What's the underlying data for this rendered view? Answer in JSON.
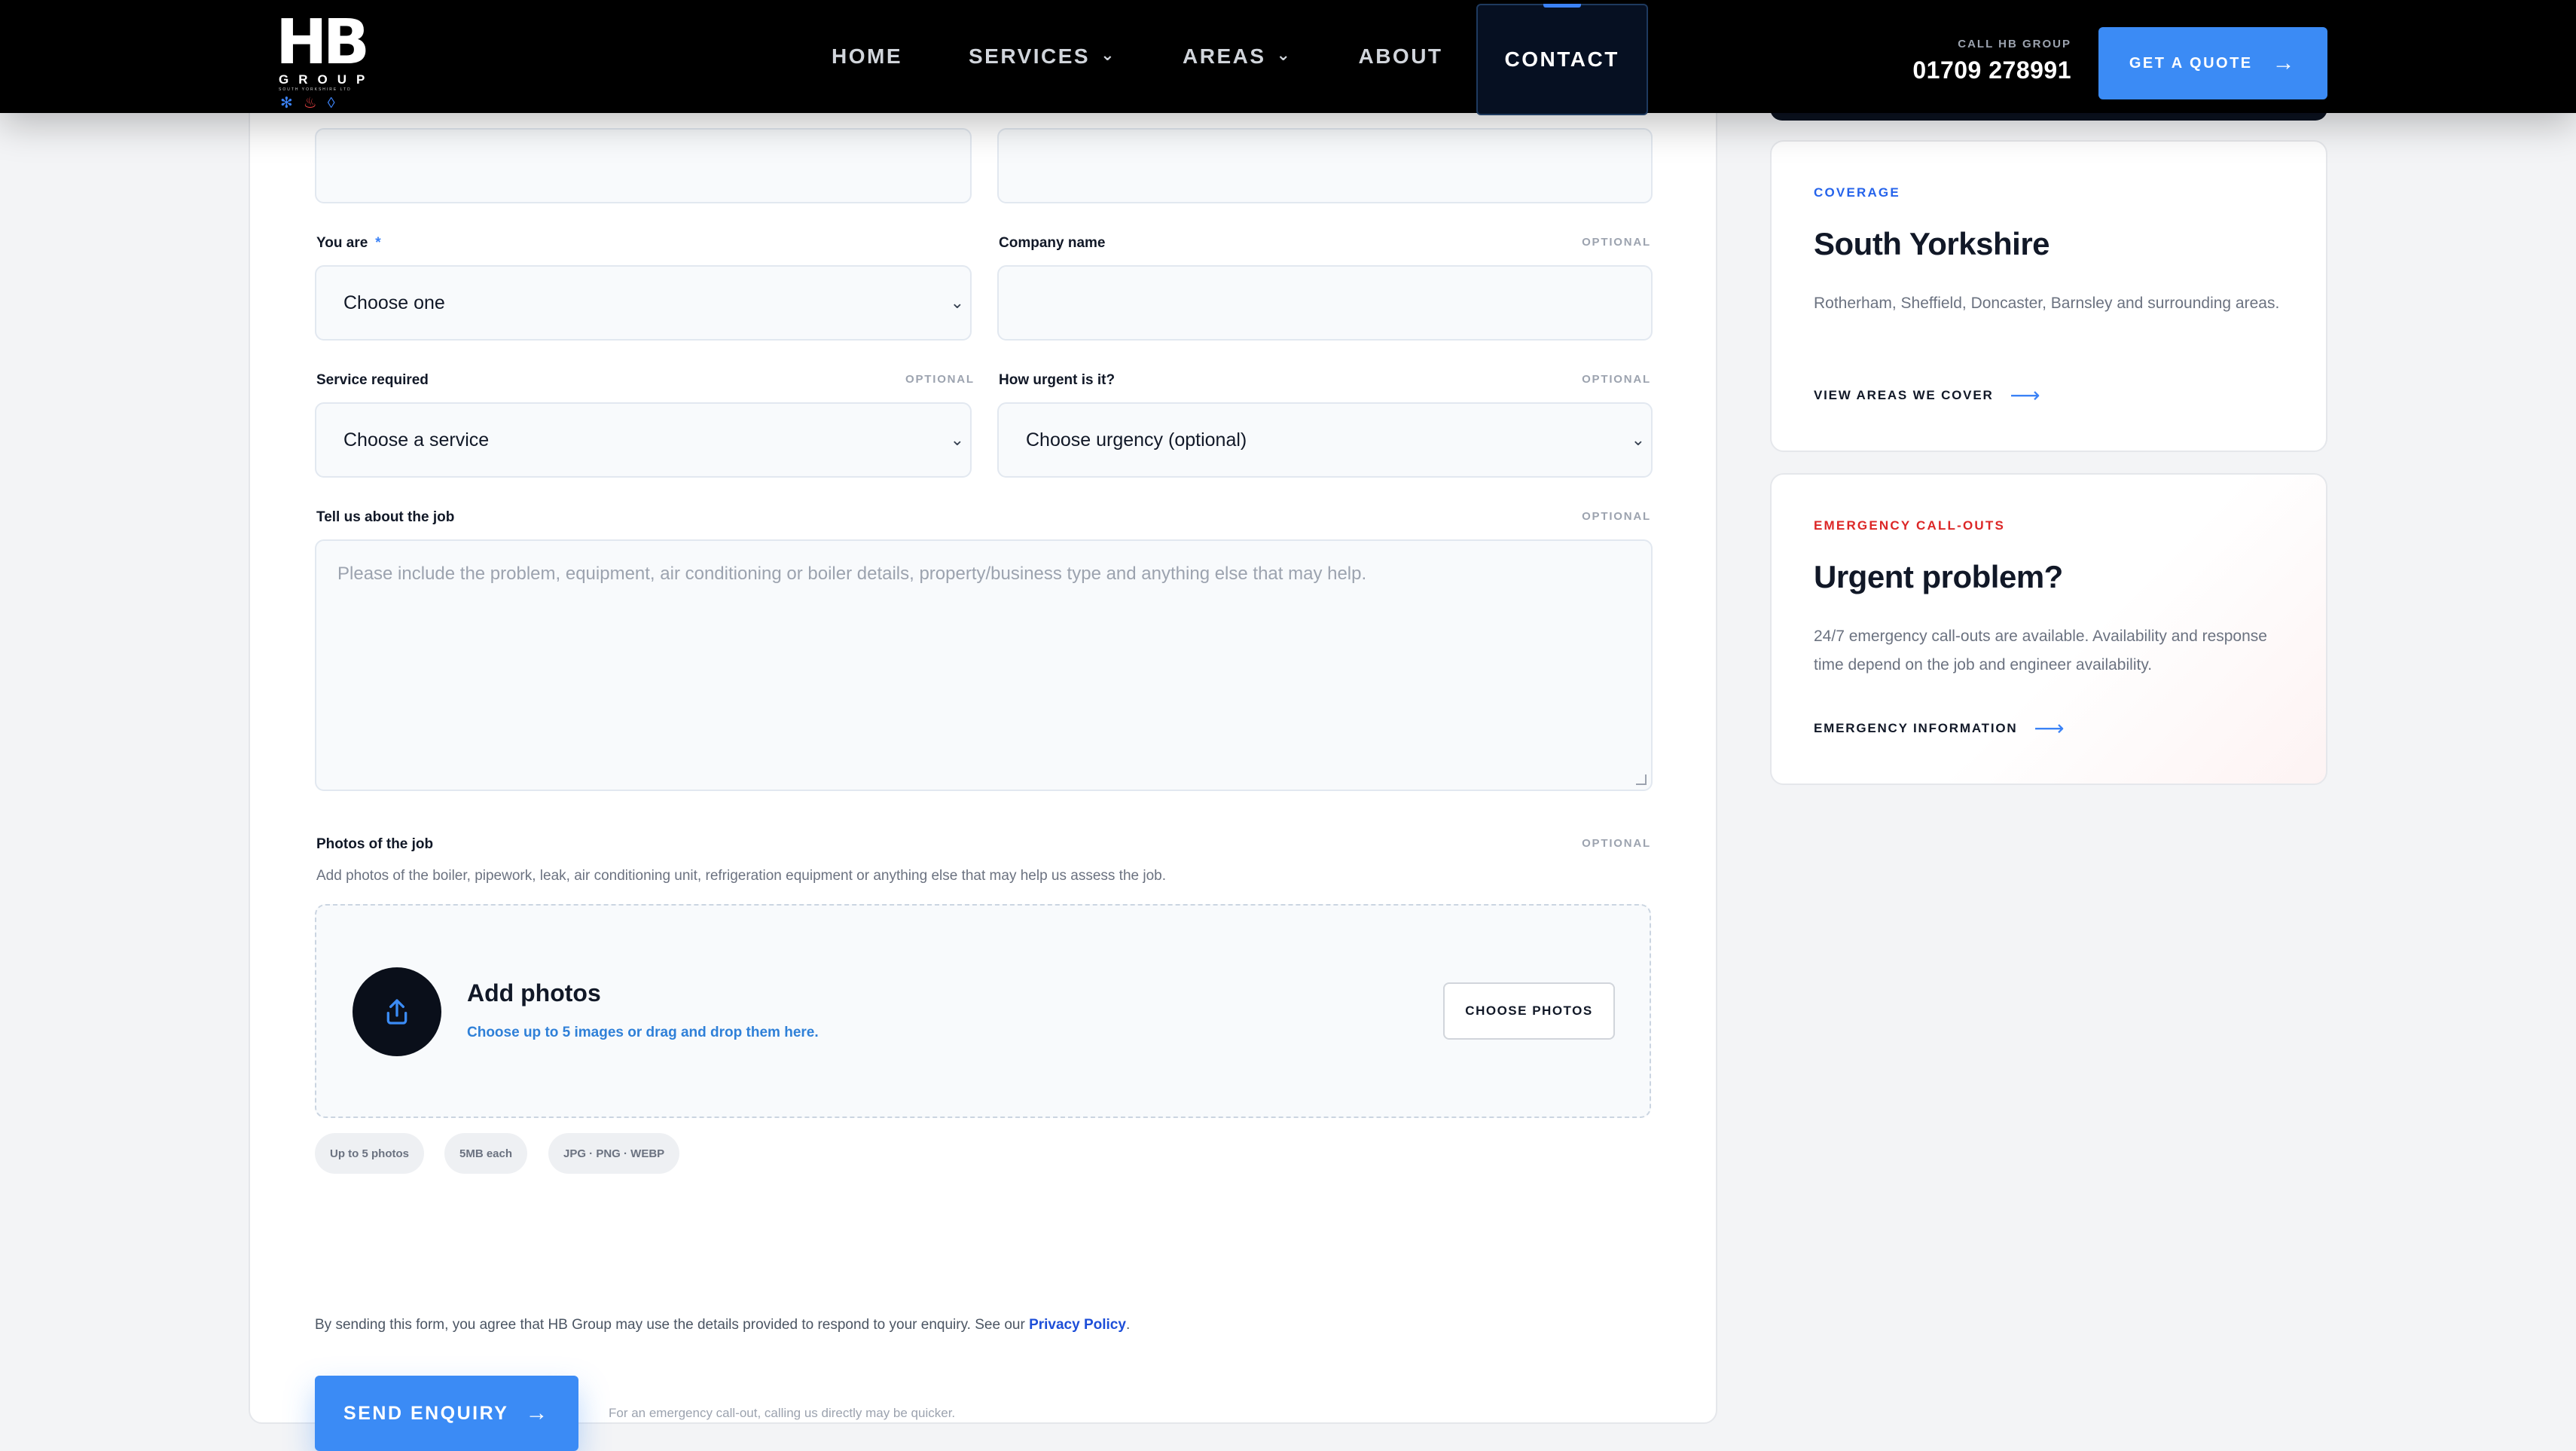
{
  "header": {
    "logo": {
      "mark": "HB",
      "word": "GROUP",
      "sub": "SOUTH YORKSHIRE LTD"
    },
    "nav": [
      {
        "label": "HOME",
        "dropdown": false
      },
      {
        "label": "SERVICES",
        "dropdown": true
      },
      {
        "label": "AREAS",
        "dropdown": true
      },
      {
        "label": "ABOUT",
        "dropdown": false
      },
      {
        "label": "CONTACT",
        "dropdown": false,
        "active": true
      }
    ],
    "call_label": "CALL HB GROUP",
    "call_number": "01709 278991",
    "quote_button": "GET A QUOTE"
  },
  "form": {
    "you_are": {
      "label": "You are",
      "required_mark": "*",
      "value": "Choose one"
    },
    "company": {
      "label": "Company name",
      "optional": "OPTIONAL",
      "value": ""
    },
    "service": {
      "label": "Service required",
      "optional": "OPTIONAL",
      "value": "Choose a service"
    },
    "urgency": {
      "label": "How urgent is it?",
      "optional": "OPTIONAL",
      "value": "Choose urgency (optional)"
    },
    "job": {
      "label": "Tell us about the job",
      "optional": "OPTIONAL",
      "placeholder": "Please include the problem, equipment, air conditioning or boiler details, property/business type and anything else that may help."
    },
    "photos": {
      "label": "Photos of the job",
      "optional": "OPTIONAL",
      "description": "Add photos of the boiler, pipework, leak, air conditioning unit, refrigeration equipment or anything else that may help us assess the job.",
      "title": "Add photos",
      "subtitle": "Choose up to 5 images or drag and drop them here.",
      "button": "CHOOSE PHOTOS",
      "chips": [
        "Up to 5 photos",
        "5MB each",
        "JPG · PNG · WEBP"
      ]
    },
    "consent_text": "By sending this form, you agree that HB Group may use the details provided to respond to your enquiry. See our ",
    "consent_link": "Privacy Policy",
    "consent_end": ".",
    "send_button": "SEND ENQUIRY",
    "send_note": "For an emergency call-out, calling us directly may be quicker."
  },
  "sidebar": {
    "coverage": {
      "eyebrow": "COVERAGE",
      "title": "South Yorkshire",
      "text": "Rotherham, Sheffield, Doncaster, Barnsley and surrounding areas.",
      "link": "VIEW AREAS WE COVER"
    },
    "emergency": {
      "eyebrow": "EMERGENCY CALL-OUTS",
      "title": "Urgent problem?",
      "text": "24/7 emergency call-outs are available. Availability and response time depend on the job and engineer availability.",
      "link": "EMERGENCY INFORMATION"
    }
  },
  "icons": {
    "chevron": "chevron-down-icon",
    "arrow": "arrow-right-icon",
    "upload": "upload-icon"
  },
  "colors": {
    "accent": "#3b8bf5",
    "coverage_eyebrow": "#2563eb",
    "emergency_eyebrow": "#dc2626",
    "header_bg": "#000000"
  }
}
